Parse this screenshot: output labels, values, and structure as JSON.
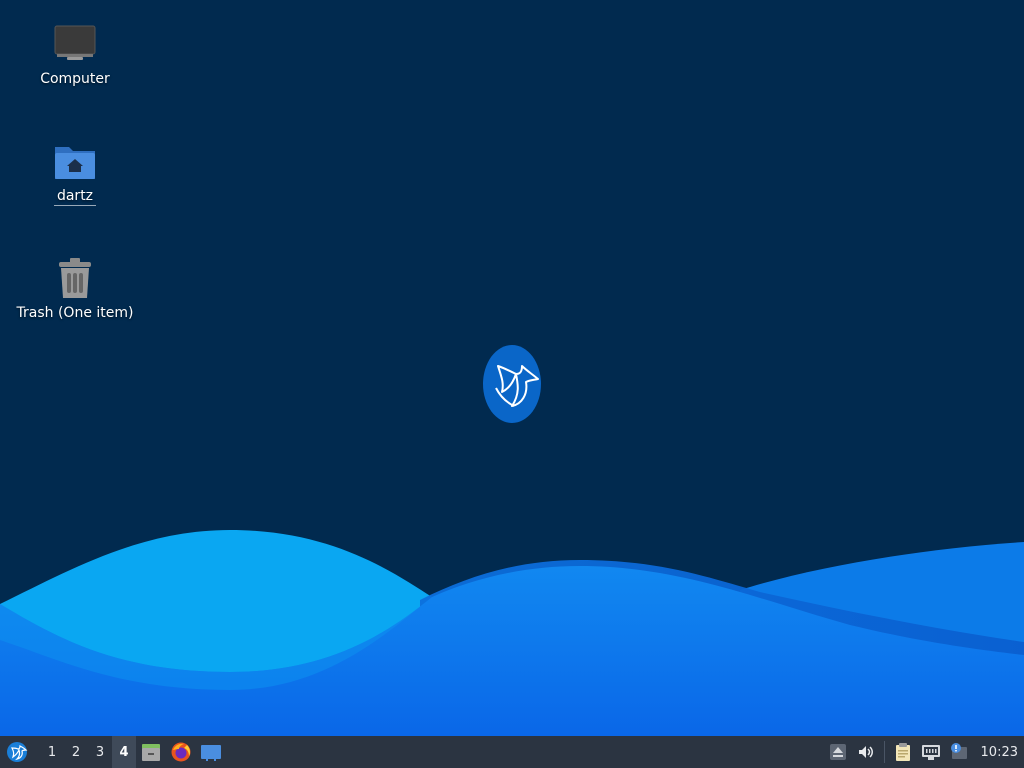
{
  "desktop": {
    "icons": [
      {
        "label": "Computer"
      },
      {
        "label": "dartz"
      },
      {
        "label": "Trash (One item)"
      }
    ]
  },
  "panel": {
    "workspaces": [
      "1",
      "2",
      "3",
      "4"
    ],
    "active_workspace": "4",
    "launchers": [
      "file-manager-icon",
      "firefox-icon",
      "desktop-icon"
    ],
    "tray": [
      "eject-icon",
      "volume-icon",
      "clipboard-icon",
      "network-icon",
      "notification-icon"
    ],
    "clock": "10:23"
  },
  "colors": {
    "background": "#012a4f",
    "panel": "#2b3441",
    "accent": "#0a6bd1"
  }
}
